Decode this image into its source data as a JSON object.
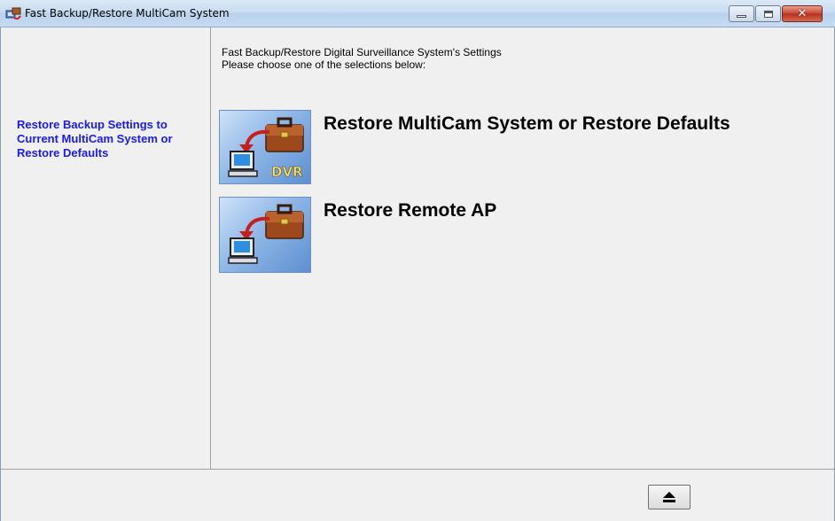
{
  "window": {
    "title": "Fast Backup/Restore MultiCam System"
  },
  "sidebar": {
    "description": "Restore Backup Settings to Current MultiCam System or Restore Defaults"
  },
  "header": {
    "line1": "Fast Backup/Restore Digital Surveillance System's Settings",
    "line2": "Please choose one of the selections below:"
  },
  "options": [
    {
      "label": "Restore MultiCam System or Restore Defaults",
      "badge": "DVR",
      "icon": "briefcase-to-computer-icon"
    },
    {
      "label": "Restore Remote AP",
      "icon": "briefcase-to-computer-icon"
    }
  ],
  "footer": {
    "eject_icon": "eject-icon"
  },
  "colors": {
    "sidebar_text": "#1a1aff",
    "icon_bg": "#8fb8e8"
  }
}
